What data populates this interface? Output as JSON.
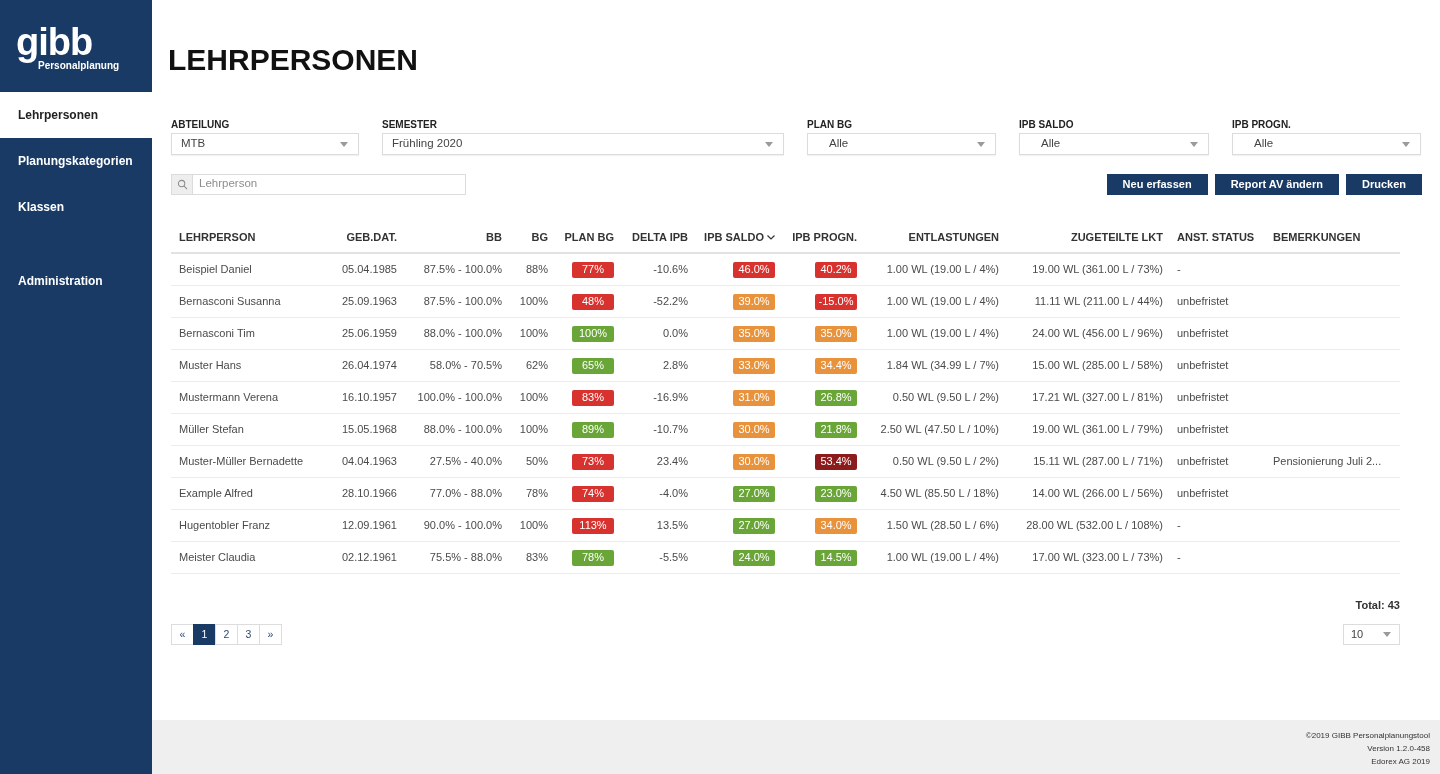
{
  "sidebar": {
    "logo": {
      "wordmark": "gibb",
      "subtitle": "Personalplanung"
    },
    "sections": [
      {
        "items": [
          {
            "label": "Lehrpersonen",
            "selected": true
          },
          {
            "label": "Planungskategorien",
            "selected": false
          },
          {
            "label": "Klassen",
            "selected": false
          }
        ]
      },
      {
        "items": [
          {
            "label": "Administration",
            "selected": false
          }
        ]
      }
    ]
  },
  "page_title": "LEHRPERSONEN",
  "filters": [
    {
      "label": "ABTEILUNG",
      "value": "MTB"
    },
    {
      "label": "SEMESTER",
      "value": "Frühling 2020"
    },
    {
      "label": "PLAN BG",
      "value": "Alle"
    },
    {
      "label": "IPB SALDO",
      "value": "Alle"
    },
    {
      "label": "IPB PROGN.",
      "value": "Alle"
    }
  ],
  "search": {
    "placeholder": "Lehrperson"
  },
  "actions": [
    "Neu erfassen",
    "Report AV ändern",
    "Drucken"
  ],
  "table": {
    "columns": [
      {
        "label": "LEHRPERSON",
        "sorted": false
      },
      {
        "label": "GEB.DAT.",
        "sorted": false
      },
      {
        "label": "BB",
        "sorted": false
      },
      {
        "label": "BG",
        "sorted": false
      },
      {
        "label": "PLAN BG",
        "sorted": false
      },
      {
        "label": "DELTA IPB",
        "sorted": false
      },
      {
        "label": "IPB SALDO",
        "sorted": true
      },
      {
        "label": "IPB PROGN.",
        "sorted": false
      },
      {
        "label": "ENTLASTUNGEN",
        "sorted": false
      },
      {
        "label": "ZUGETEILTE LKT",
        "sorted": false
      },
      {
        "label": "ANST. STATUS",
        "sorted": false
      },
      {
        "label": "BEMERKUNGEN",
        "sorted": false
      }
    ],
    "rows": [
      {
        "lehrperson": "Beispiel Daniel",
        "geb_dat": "05.04.1985",
        "bb": "87.5% - 100.0%",
        "bg": "88%",
        "plan_bg": {
          "text": "77%",
          "color": "#d8322e"
        },
        "delta_ipb": "-10.6%",
        "ipb_saldo": {
          "text": "46.0%",
          "color": "#d8322e"
        },
        "ipb_progn": {
          "text": "40.2%",
          "color": "#d8322e"
        },
        "entlastungen": "1.00 WL (19.00 L / 4%)",
        "zugeteilte_lkt": "19.00 WL (361.00 L / 73%)",
        "anst_status": "-"
      },
      {
        "lehrperson": "Bernasconi Susanna",
        "geb_dat": "25.09.1963",
        "bb": "87.5% - 100.0%",
        "bg": "100%",
        "plan_bg": {
          "text": "48%",
          "color": "#d8322e"
        },
        "delta_ipb": "-52.2%",
        "ipb_saldo": {
          "text": "39.0%",
          "color": "#e8923c"
        },
        "ipb_progn": {
          "text": "-15.0%",
          "color": "#d8322e"
        },
        "entlastungen": "1.00 WL (19.00 L / 4%)",
        "zugeteilte_lkt": "11.11 WL (211.00 L / 44%)",
        "anst_status": "unbefristet"
      },
      {
        "lehrperson": "Bernasconi Tim",
        "geb_dat": "25.06.1959",
        "bb": "88.0% - 100.0%",
        "bg": "100%",
        "plan_bg": {
          "text": "100%",
          "color": "#6aa538"
        },
        "delta_ipb": "0.0%",
        "ipb_saldo": {
          "text": "35.0%",
          "color": "#e8923c"
        },
        "ipb_progn": {
          "text": "35.0%",
          "color": "#e8923c"
        },
        "entlastungen": "1.00 WL (19.00 L / 4%)",
        "zugeteilte_lkt": "24.00 WL (456.00 L / 96%)",
        "anst_status": "unbefristet"
      },
      {
        "lehrperson": "Muster Hans",
        "geb_dat": "26.04.1974",
        "bb": "58.0% - 70.5%",
        "bg": "62%",
        "plan_bg": {
          "text": "65%",
          "color": "#6aa538"
        },
        "delta_ipb": "2.8%",
        "ipb_saldo": {
          "text": "33.0%",
          "color": "#e8923c"
        },
        "ipb_progn": {
          "text": "34.4%",
          "color": "#e8923c"
        },
        "entlastungen": "1.84 WL (34.99 L / 7%)",
        "zugeteilte_lkt": "15.00 WL (285.00 L / 58%)",
        "anst_status": "unbefristet"
      },
      {
        "lehrperson": "Mustermann Verena",
        "geb_dat": "16.10.1957",
        "bb": "100.0% - 100.0%",
        "bg": "100%",
        "plan_bg": {
          "text": "83%",
          "color": "#d8322e"
        },
        "delta_ipb": "-16.9%",
        "ipb_saldo": {
          "text": "31.0%",
          "color": "#e8923c"
        },
        "ipb_progn": {
          "text": "26.8%",
          "color": "#6aa538"
        },
        "entlastungen": "0.50 WL (9.50 L / 2%)",
        "zugeteilte_lkt": "17.21 WL (327.00 L / 81%)",
        "anst_status": "unbefristet"
      },
      {
        "lehrperson": "Müller Stefan",
        "geb_dat": "15.05.1968",
        "bb": "88.0% - 100.0%",
        "bg": "100%",
        "plan_bg": {
          "text": "89%",
          "color": "#6aa538"
        },
        "delta_ipb": "-10.7%",
        "ipb_saldo": {
          "text": "30.0%",
          "color": "#e8923c"
        },
        "ipb_progn": {
          "text": "21.8%",
          "color": "#6aa538"
        },
        "entlastungen": "2.50 WL (47.50 L / 10%)",
        "zugeteilte_lkt": "19.00 WL (361.00 L / 79%)",
        "anst_status": "unbefristet"
      },
      {
        "lehrperson": "Muster-Müller Bernadette",
        "geb_dat": "04.04.1963",
        "bb": "27.5% - 40.0%",
        "bg": "50%",
        "plan_bg": {
          "text": "73%",
          "color": "#d8322e"
        },
        "delta_ipb": "23.4%",
        "ipb_saldo": {
          "text": "30.0%",
          "color": "#e8923c"
        },
        "ipb_progn": {
          "text": "53.4%",
          "color": "#8c1c1c"
        },
        "entlastungen": "0.50 WL (9.50 L / 2%)",
        "zugeteilte_lkt": "15.11 WL (287.00 L / 71%)",
        "anst_status": "unbefristet",
        "bemerkungen": "Pensionierung Juli 2..."
      },
      {
        "lehrperson": "Example Alfred",
        "geb_dat": "28.10.1966",
        "bb": "77.0% - 88.0%",
        "bg": "78%",
        "plan_bg": {
          "text": "74%",
          "color": "#d8322e"
        },
        "delta_ipb": "-4.0%",
        "ipb_saldo": {
          "text": "27.0%",
          "color": "#6aa538"
        },
        "ipb_progn": {
          "text": "23.0%",
          "color": "#6aa538"
        },
        "entlastungen": "4.50 WL (85.50 L / 18%)",
        "zugeteilte_lkt": "14.00 WL (266.00 L / 56%)",
        "anst_status": "unbefristet"
      },
      {
        "lehrperson": "Hugentobler Franz",
        "geb_dat": "12.09.1961",
        "bb": "90.0% - 100.0%",
        "bg": "100%",
        "plan_bg": {
          "text": "113%",
          "color": "#d8322e"
        },
        "delta_ipb": "13.5%",
        "ipb_saldo": {
          "text": "27.0%",
          "color": "#6aa538"
        },
        "ipb_progn": {
          "text": "34.0%",
          "color": "#e8923c"
        },
        "entlastungen": "1.50 WL (28.50 L / 6%)",
        "zugeteilte_lkt": "28.00 WL (532.00 L / 108%)",
        "anst_status": "-"
      },
      {
        "lehrperson": "Meister Claudia",
        "geb_dat": "02.12.1961",
        "bb": "75.5% - 88.0%",
        "bg": "83%",
        "plan_bg": {
          "text": "78%",
          "color": "#6aa538"
        },
        "delta_ipb": "-5.5%",
        "ipb_saldo": {
          "text": "24.0%",
          "color": "#6aa538"
        },
        "ipb_progn": {
          "text": "14.5%",
          "color": "#6aa538"
        },
        "entlastungen": "1.00 WL (19.00 L / 4%)",
        "zugeteilte_lkt": "17.00 WL (323.00 L / 73%)",
        "anst_status": "-"
      }
    ]
  },
  "total": "Total: 43",
  "pagination": {
    "pages": [
      {
        "label": "«",
        "selected": false
      },
      {
        "label": "1",
        "selected": true
      },
      {
        "label": "2",
        "selected": false
      },
      {
        "label": "3",
        "selected": false
      },
      {
        "label": "»",
        "selected": false
      }
    ]
  },
  "page_size": "10",
  "footer": [
    "©2019 GIBB Personalplanungstool",
    "Version 1.2.0-458",
    "Edorex AG 2019"
  ]
}
